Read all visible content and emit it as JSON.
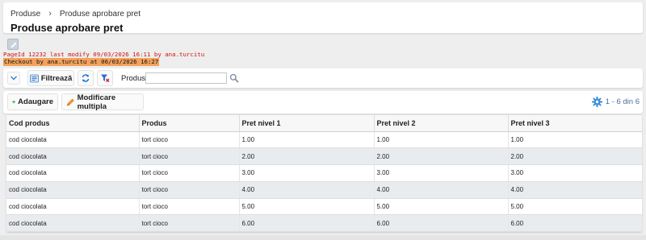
{
  "breadcrumb": {
    "root": "Produse",
    "separator": "›",
    "current": "Produse aprobare pret"
  },
  "page_title": "Produse aprobare pret",
  "record_info": {
    "modify": "PageId 12232 last modify 09/03/2026 16:11 by ana.turcitu",
    "checkout": "Checkout by ana.turcitu at 06/03/2026 16:27"
  },
  "filterbar": {
    "filter_label": "Filtrează",
    "produs_label": "Produs",
    "produs_value": "",
    "produs_placeholder": ""
  },
  "toolbar": {
    "add_label": "Adaugare",
    "multi_edit_label": "Modificare multipla",
    "record_count": "1 - 6 din 6"
  },
  "table": {
    "columns": [
      "Cod produs",
      "Produs",
      "Pret nivel 1",
      "Pret nivel 2",
      "Pret nivel 3"
    ],
    "rows": [
      [
        "cod ciocolata",
        "tort cioco",
        "1.00",
        "1.00",
        "1.00"
      ],
      [
        "cod ciocolata",
        "tort cioco",
        "2.00",
        "2.00",
        "2.00"
      ],
      [
        "cod ciocolata",
        "tort cioco",
        "3.00",
        "3.00",
        "3.00"
      ],
      [
        "cod ciocolata",
        "tort cioco",
        "4.00",
        "4.00",
        "4.00"
      ],
      [
        "cod ciocolata",
        "tort cioco",
        "5.00",
        "5.00",
        "5.00"
      ],
      [
        "cod ciocolata",
        "tort cioco",
        "6.00",
        "6.00",
        "6.00"
      ]
    ]
  },
  "colors": {
    "accent": "#3a7fd0",
    "modify_text": "#d01010",
    "checkout_bg": "#f2a25c",
    "row_alt": "#e9ecef"
  },
  "icons": {
    "edit": "edit-icon",
    "chevron": "chevron-down-icon",
    "filter": "filter-icon",
    "refresh": "refresh-icon",
    "clear_filter": "clear-filter-icon",
    "search": "search-icon",
    "add": "plus-icon",
    "multi_edit": "pencil-icon",
    "settings": "gear-icon"
  }
}
